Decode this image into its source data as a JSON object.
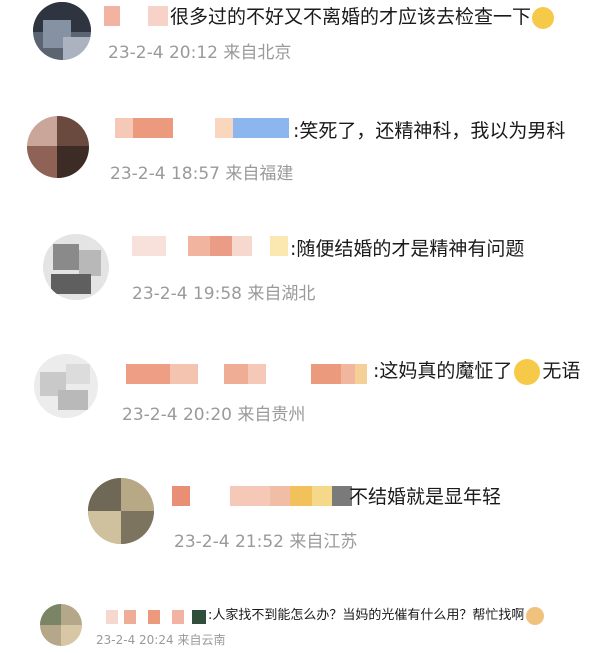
{
  "comments": [
    {
      "text": "很多过的不好又不离婚的才应该去检查一下",
      "date": "23-2-4",
      "time": "20:12",
      "location": "来自北京",
      "trailing_icon": "laugh-cry-emoji-icon"
    },
    {
      "text": ":笑死了，还精神科，我以为男科",
      "date": "23-2-4",
      "time": "18:57",
      "location": "来自福建"
    },
    {
      "text": ":随便结婚的才是精神有问题",
      "date": "23-2-4",
      "time": "19:58",
      "location": "来自湖北"
    },
    {
      "text": ":这妈真的魔怔了",
      "text_after": "无语",
      "inline_icon": "shrug-emoji-icon",
      "date": "23-2-4",
      "time": "20:20",
      "location": "来自贵州"
    },
    {
      "text": "不结婚就是显年轻",
      "date": "23-2-4",
      "time": "21:52",
      "location": "来自江苏"
    },
    {
      "text": ":人家找不到能怎么办？当妈的光催有什么用？帮忙找啊",
      "trailing_icon": "doge-emoji-icon",
      "date": "23-2-4",
      "time": "20:24",
      "location": "来自云南"
    }
  ]
}
